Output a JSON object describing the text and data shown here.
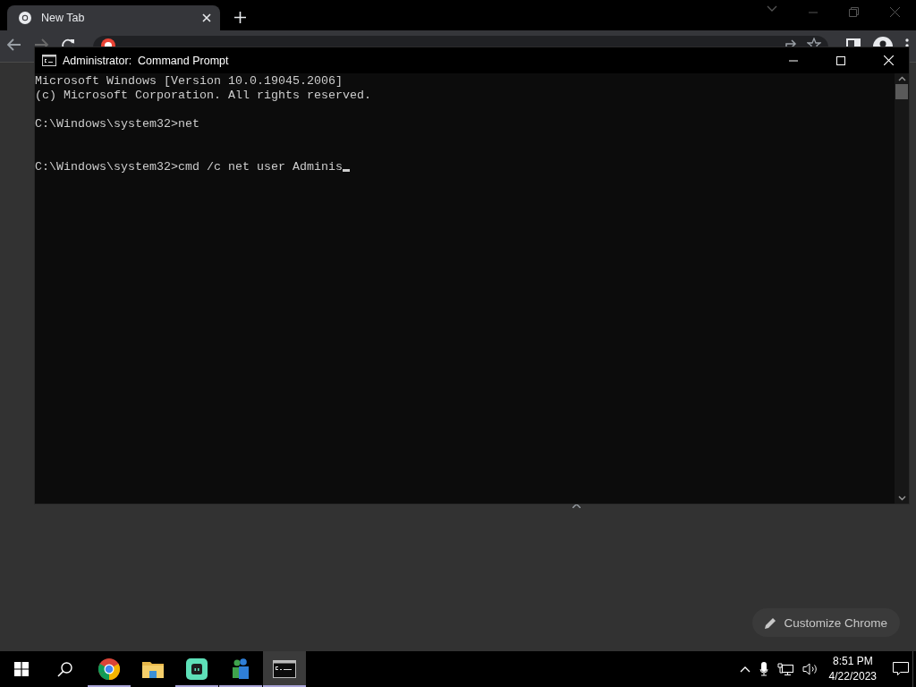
{
  "browser": {
    "tab": {
      "title": "New Tab",
      "selected": true
    },
    "customize_button": "Customize Chrome"
  },
  "console": {
    "title": "Administrator:  Command Prompt",
    "lines": [
      {
        "kind": "output",
        "text": "Microsoft Windows [Version 10.0.19045.2006]"
      },
      {
        "kind": "output",
        "text": "(c) Microsoft Corporation. All rights reserved."
      },
      {
        "kind": "blank"
      },
      {
        "kind": "input",
        "text": "C:\\Windows\\system32>net",
        "cursor": false
      },
      {
        "kind": "blank"
      },
      {
        "kind": "blank"
      },
      {
        "kind": "input",
        "text": "C:\\Windows\\system32>cmd /c net user Adminis",
        "cursor": true
      }
    ]
  },
  "taskbar": {
    "apps": [
      {
        "kind": "chrome",
        "running": true,
        "selected": false
      },
      {
        "kind": "folder",
        "running": false,
        "selected": false
      },
      {
        "kind": "chat",
        "running": true,
        "selected": false
      },
      {
        "kind": "people",
        "running": true,
        "selected": false
      },
      {
        "kind": "terminal",
        "running": true,
        "selected": true
      }
    ],
    "time": "8:51 PM",
    "date": "4/22/2023"
  }
}
